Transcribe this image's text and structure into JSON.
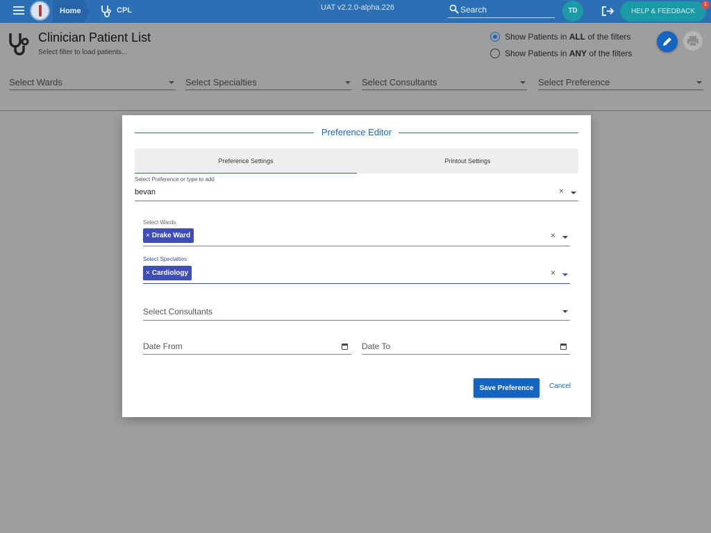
{
  "topbar": {
    "home_label": "Home",
    "cpl_label": "CPL",
    "version": "UAT v2.2.0-alpha.226",
    "search_placeholder": "Search",
    "avatar_initials": "TD",
    "help_label": "HELP & FEEDBACK",
    "help_badge": "1"
  },
  "page": {
    "title": "Clinician Patient List",
    "subtitle": "Select filter to load patients...",
    "radio_all_prefix": "Show Patients in ",
    "radio_all_bold": "ALL",
    "radio_all_suffix": " of the filters",
    "radio_any_prefix": "Show Patients in ",
    "radio_any_bold": "ANY",
    "radio_any_suffix": " of the filters",
    "filters": {
      "wards": "Select Wards",
      "specialties": "Select Specialties",
      "consultants": "Select Consultants",
      "preference": "Select Preference"
    }
  },
  "dialog": {
    "title": "Preference Editor",
    "tabs": [
      "Preference Settings",
      "Printout Settings"
    ],
    "preference_label": "Select Preference or type to add",
    "preference_value": "bevan",
    "wards_label": "Select Wards",
    "wards_chip": "Drake Ward",
    "specialties_label": "Select Specialties",
    "specialties_chip": "Cardiology",
    "consultants_placeholder": "Select Consultants",
    "date_from_placeholder": "Date From",
    "date_to_placeholder": "Date To",
    "save_label": "Save Preference",
    "cancel_label": "Cancel",
    "chip_remove": "×",
    "clear_symbol": "×"
  },
  "colors": {
    "primary": "#1565c0",
    "topbar": "#2b6fb5",
    "chip": "#3f4db8",
    "teal": "#1a9aa5"
  }
}
